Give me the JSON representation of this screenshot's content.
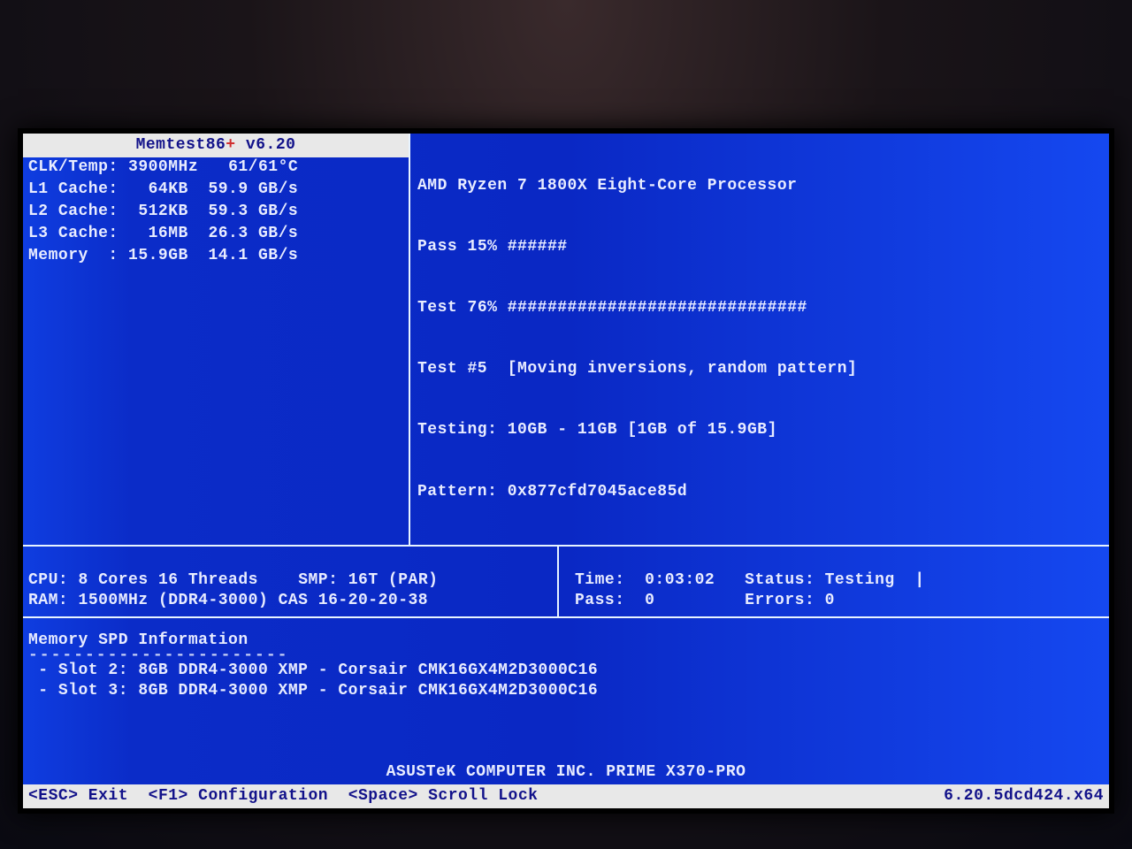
{
  "title": {
    "name": "Memtest86",
    "plus": "+",
    "version": " v6.20"
  },
  "left_stats": {
    "clk_temp_label": "CLK/Temp:",
    "clk": "3900MHz",
    "temp": "61/61°C",
    "l1_label": "L1 Cache:",
    "l1_size": "64KB",
    "l1_bw": "59.9 GB/s",
    "l2_label": "L2 Cache:",
    "l2_size": "512KB",
    "l2_bw": "59.3 GB/s",
    "l3_label": "L3 Cache:",
    "l3_size": "16MB",
    "l3_bw": "26.3 GB/s",
    "mem_label": "Memory  :",
    "mem_size": "15.9GB",
    "mem_bw": "14.1 GB/s"
  },
  "right_stats": {
    "cpu_name": "AMD Ryzen 7 1800X Eight-Core Processor",
    "pass_label": "Pass",
    "pass_pct": "15%",
    "pass_bar": "######",
    "test_label": "Test",
    "test_pct": "76%",
    "test_bar": "##############################",
    "test_num_label": "Test #5",
    "test_desc": "[Moving inversions, random pattern]",
    "testing_label": "Testing:",
    "testing_range": "10GB - 11GB [1GB of 15.9GB]",
    "pattern_label": "Pattern:",
    "pattern_val": "0x877cfd7045ace85d"
  },
  "mid": {
    "cpu_label": "CPU:",
    "cpu_val": "8 Cores 16 Threads",
    "smp_label": "SMP:",
    "smp_val": "16T (PAR)",
    "ram_label": "RAM:",
    "ram_val": "1500MHz (DDR4-3000) CAS 16-20-20-38",
    "time_label": "Time:",
    "time_val": "0:03:02",
    "status_label": "Status:",
    "status_val": "Testing",
    "spinner": "|",
    "pass_label": "Pass:",
    "pass_val": "0",
    "errors_label": "Errors:",
    "errors_val": "0"
  },
  "spd": {
    "title": "Memory SPD Information",
    "underline": "-----------------------",
    "slots": [
      " - Slot 2: 8GB DDR4-3000 XMP - Corsair CMK16GX4M2D3000C16",
      " - Slot 3: 8GB DDR4-3000 XMP - Corsair CMK16GX4M2D3000C16"
    ]
  },
  "mobo": "ASUSTeK COMPUTER INC. PRIME X370-PRO",
  "footer": {
    "esc": "<ESC> Exit",
    "f1": "<F1> Configuration",
    "space": "<Space> Scroll Lock",
    "build": "6.20.5dcd424.x64"
  }
}
